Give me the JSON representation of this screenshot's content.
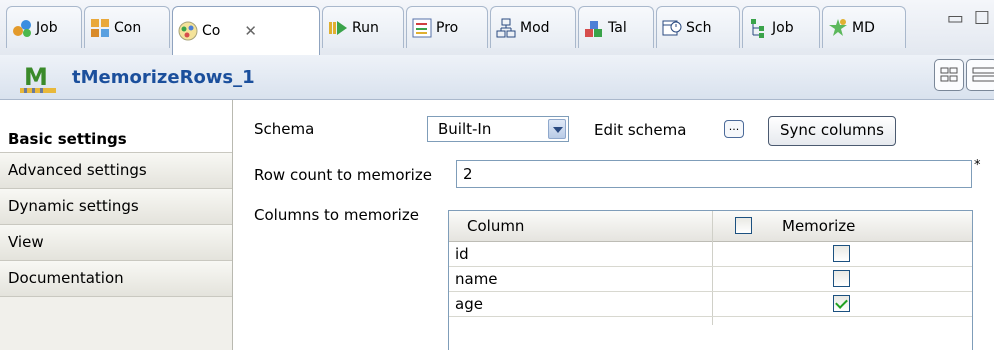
{
  "tabs": [
    {
      "label": "Job",
      "icon": "job-icon"
    },
    {
      "label": "Con",
      "icon": "contexts-icon"
    },
    {
      "label": "Co",
      "icon": "component-icon",
      "active": true
    },
    {
      "label": "Run",
      "icon": "run-icon"
    },
    {
      "label": "Pro",
      "icon": "problems-icon"
    },
    {
      "label": "Mod",
      "icon": "modules-icon"
    },
    {
      "label": "Tal",
      "icon": "talend-icon"
    },
    {
      "label": "Sch",
      "icon": "scheduler-icon"
    },
    {
      "label": "Job",
      "icon": "job-hierarchy-icon"
    },
    {
      "label": "MD",
      "icon": "metadata-icon"
    }
  ],
  "header": {
    "component_name": "tMemorizeRows_1"
  },
  "sidebar": {
    "items": [
      {
        "label": "Basic settings",
        "active": true
      },
      {
        "label": "Advanced settings"
      },
      {
        "label": "Dynamic settings"
      },
      {
        "label": "View"
      },
      {
        "label": "Documentation"
      }
    ]
  },
  "form": {
    "schema_label": "Schema",
    "schema_value": "Built-In",
    "edit_schema_label": "Edit schema",
    "edit_schema_button": "...",
    "sync_columns_label": "Sync columns",
    "row_count_label": "Row count to memorize",
    "row_count_value": "2",
    "required_marker": "*",
    "columns_label": "Columns to memorize"
  },
  "table": {
    "headers": {
      "column": "Column",
      "memorize": "Memorize"
    },
    "rows": [
      {
        "column": "id",
        "memorize": false
      },
      {
        "column": "name",
        "memorize": false
      },
      {
        "column": "age",
        "memorize": true
      }
    ]
  },
  "colors": {
    "title": "#1b4f9c",
    "check": "#21a121"
  }
}
